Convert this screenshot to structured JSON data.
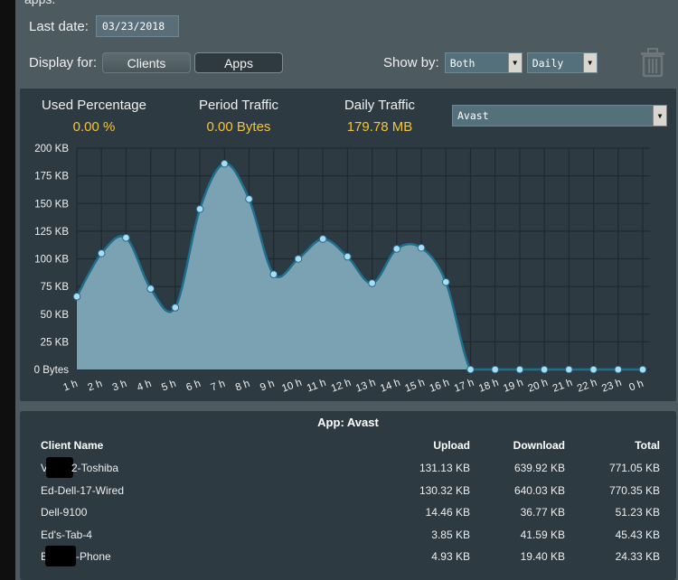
{
  "header": {
    "cut_text": "apps.",
    "last_date_label": "Last date:",
    "last_date_value": "03/23/2018",
    "display_for_label": "Display for:",
    "display_for_options": [
      "Clients",
      "Apps"
    ],
    "display_for_selected": "Apps",
    "show_by_label": "Show by:",
    "show_by_direction": "Both",
    "show_by_period": "Daily",
    "delete_icon": "trash-icon"
  },
  "stats": {
    "used_percentage_label": "Used Percentage",
    "used_percentage_value": "0.00 %",
    "period_traffic_label": "Period Traffic",
    "period_traffic_value": "0.00 Bytes",
    "daily_traffic_label": "Daily Traffic",
    "daily_traffic_value": "179.78 MB",
    "app_selected": "Avast"
  },
  "colors": {
    "accent_value": "#f3c538",
    "area_fill": "#7aa2b2",
    "line": "#1e6f8f",
    "point": "#a8def5"
  },
  "chart_data": {
    "type": "area",
    "title": "",
    "xlabel": "",
    "ylabel": "",
    "categories": [
      "1 h",
      "2 h",
      "3 h",
      "4 h",
      "5 h",
      "6 h",
      "7 h",
      "8 h",
      "9 h",
      "10 h",
      "11 h",
      "12 h",
      "13 h",
      "14 h",
      "15 h",
      "16 h",
      "17 h",
      "18 h",
      "19 h",
      "20 h",
      "21 h",
      "22 h",
      "23 h",
      "0 h"
    ],
    "values": [
      66,
      105,
      119,
      73,
      56,
      145,
      186,
      154,
      86,
      100,
      118,
      102,
      78,
      109,
      110,
      79,
      0,
      0,
      0,
      0,
      0,
      0,
      0,
      0
    ],
    "unit": "KB",
    "ylim": [
      0,
      200
    ],
    "yticks": [
      0,
      25,
      50,
      75,
      100,
      125,
      150,
      175,
      200
    ],
    "ytick_labels": [
      "0 Bytes",
      "25 KB",
      "50 KB",
      "75 KB",
      "100 KB",
      "125 KB",
      "150 KB",
      "175 KB",
      "200 KB"
    ],
    "grid": true,
    "legend": "none"
  },
  "table": {
    "title": "App: Avast",
    "columns": [
      "Client Name",
      "Upload",
      "Download",
      "Total"
    ],
    "rows": [
      {
        "name_prefix": "V",
        "name_suffix": "2-Toshiba",
        "redacted": true,
        "upload": "131.13 KB",
        "download": "639.92 KB",
        "total": "771.05 KB"
      },
      {
        "name_prefix": "Ed-Dell-17-Wired",
        "name_suffix": "",
        "redacted": false,
        "upload": "130.32 KB",
        "download": "640.03 KB",
        "total": "770.35 KB"
      },
      {
        "name_prefix": "Dell-9100",
        "name_suffix": "",
        "redacted": false,
        "upload": "14.46 KB",
        "download": "36.77 KB",
        "total": "51.23 KB"
      },
      {
        "name_prefix": "Ed's-Tab-4",
        "name_suffix": "",
        "redacted": false,
        "upload": "3.85 KB",
        "download": "41.59 KB",
        "total": "45.43 KB"
      },
      {
        "name_prefix": "B",
        "name_suffix": "-Phone",
        "redacted": true,
        "upload": "4.93 KB",
        "download": "19.40 KB",
        "total": "24.33 KB"
      }
    ]
  }
}
